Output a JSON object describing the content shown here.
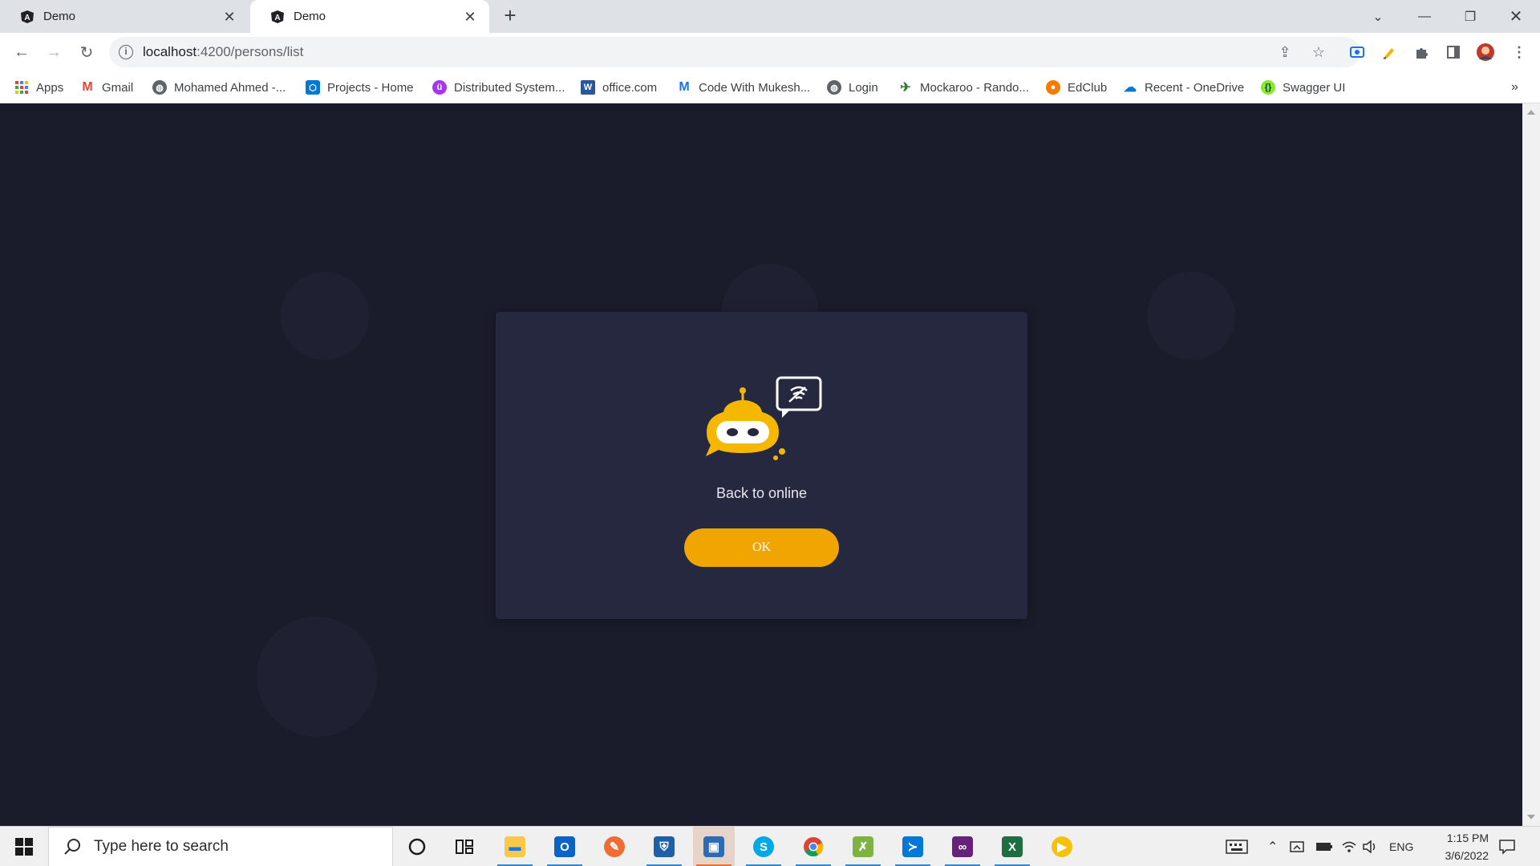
{
  "browser": {
    "tabs": [
      {
        "title": "Demo",
        "active": false
      },
      {
        "title": "Demo",
        "active": true
      }
    ],
    "address": {
      "host": "localhost",
      "path": ":4200/persons/list"
    },
    "bookmarks": [
      {
        "label": "Apps",
        "icon": "apps-grid-icon"
      },
      {
        "label": "Gmail",
        "icon": "gmail-icon"
      },
      {
        "label": "Mohamed Ahmed -...",
        "icon": "globe-icon"
      },
      {
        "label": "Projects - Home",
        "icon": "azure-devops-icon"
      },
      {
        "label": "Distributed System...",
        "icon": "udemy-icon"
      },
      {
        "label": "office.com",
        "icon": "word-icon"
      },
      {
        "label": "Code With Mukesh...",
        "icon": "mail-icon"
      },
      {
        "label": "Login",
        "icon": "globe-icon"
      },
      {
        "label": "Mockaroo - Rando...",
        "icon": "mockaroo-icon"
      },
      {
        "label": "EdClub",
        "icon": "edclub-icon"
      },
      {
        "label": "Recent - OneDrive",
        "icon": "onedrive-icon"
      },
      {
        "label": "Swagger UI",
        "icon": "swagger-icon"
      }
    ],
    "overflow_label": "»"
  },
  "modal": {
    "message": "Back to online",
    "ok_label": "OK",
    "accent_color": "#f0a500"
  },
  "taskbar": {
    "search_placeholder": "Type here to search",
    "language": "ENG",
    "time": "1:15 PM",
    "date": "3/6/2022"
  }
}
